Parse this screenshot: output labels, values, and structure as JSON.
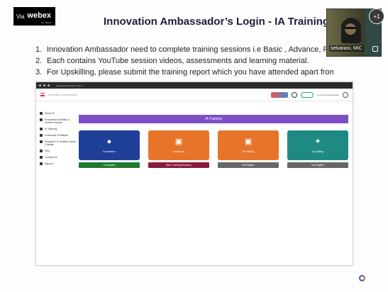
{
  "overlay": {
    "via": "Via",
    "brand": "webex",
    "brand_sub": "by CISCO",
    "participant_name": "selvarani, MIC",
    "participant_count": "+1"
  },
  "slide": {
    "title": "Innovation Ambassador’s Login  - IA Training",
    "points": [
      {
        "num": "1.",
        "text": "Innovation Ambassador need to complete training sessions i.e Basic , Advance, Re-skilling and U"
      },
      {
        "num": "2.",
        "text": "Each contains YouTube session videos, assessments and learning material."
      },
      {
        "num": "3.",
        "text": "For Upskilling, please submit the training report which you have attended apart from MIC."
      }
    ]
  },
  "screenshot": {
    "url": "www.yearofinnovation.mic.in",
    "app_title": "Innovation Ambassador",
    "user_name": "Innovation Ambassador",
    "sidebar": [
      {
        "label": "About IA"
      },
      {
        "label": "Prescribed Activities & Submit Reports"
      },
      {
        "label": "IA Training"
      },
      {
        "label": "Download Certificate"
      },
      {
        "label": "Request For Institute Name Change"
      },
      {
        "label": "FAQ"
      },
      {
        "label": "Contact Us"
      },
      {
        "label": "Signout"
      }
    ],
    "section_title": "IA Training",
    "cards": [
      {
        "label": "Foundation",
        "status": "Completed",
        "tile_color": "#1f3f96",
        "status_color": "#1f7a2e",
        "icon": "brain"
      },
      {
        "label": "Advanced",
        "status": "Start Training Sessions",
        "tile_color": "#e8742a",
        "status_color": "#8a1a3c",
        "icon": "presentation"
      },
      {
        "label": "Re-Skilling",
        "status": "Not Eligible",
        "tile_color": "#e8742a",
        "status_color": "#666666",
        "icon": "presentation"
      },
      {
        "label": "Up-Skilling",
        "status": "Not Eligible",
        "tile_color": "#1f8a84",
        "status_color": "#666666",
        "icon": "runner"
      }
    ]
  }
}
